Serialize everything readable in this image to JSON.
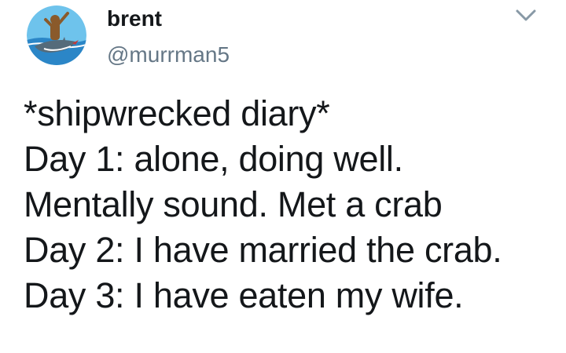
{
  "user": {
    "display_name": "brent",
    "handle": "@murrman5",
    "avatar_icon": "surfer-on-shark-avatar"
  },
  "menu": {
    "icon": "chevron-down-icon"
  },
  "tweet": {
    "lines": [
      "*shipwrecked diary*",
      "Day 1: alone, doing well.",
      "Mentally sound. Met a crab",
      "Day 2: I have married the crab.",
      "Day 3: I have eaten my wife."
    ]
  },
  "colors": {
    "text": "#14171a",
    "handle": "#657786",
    "chevron": "#8899a6"
  }
}
